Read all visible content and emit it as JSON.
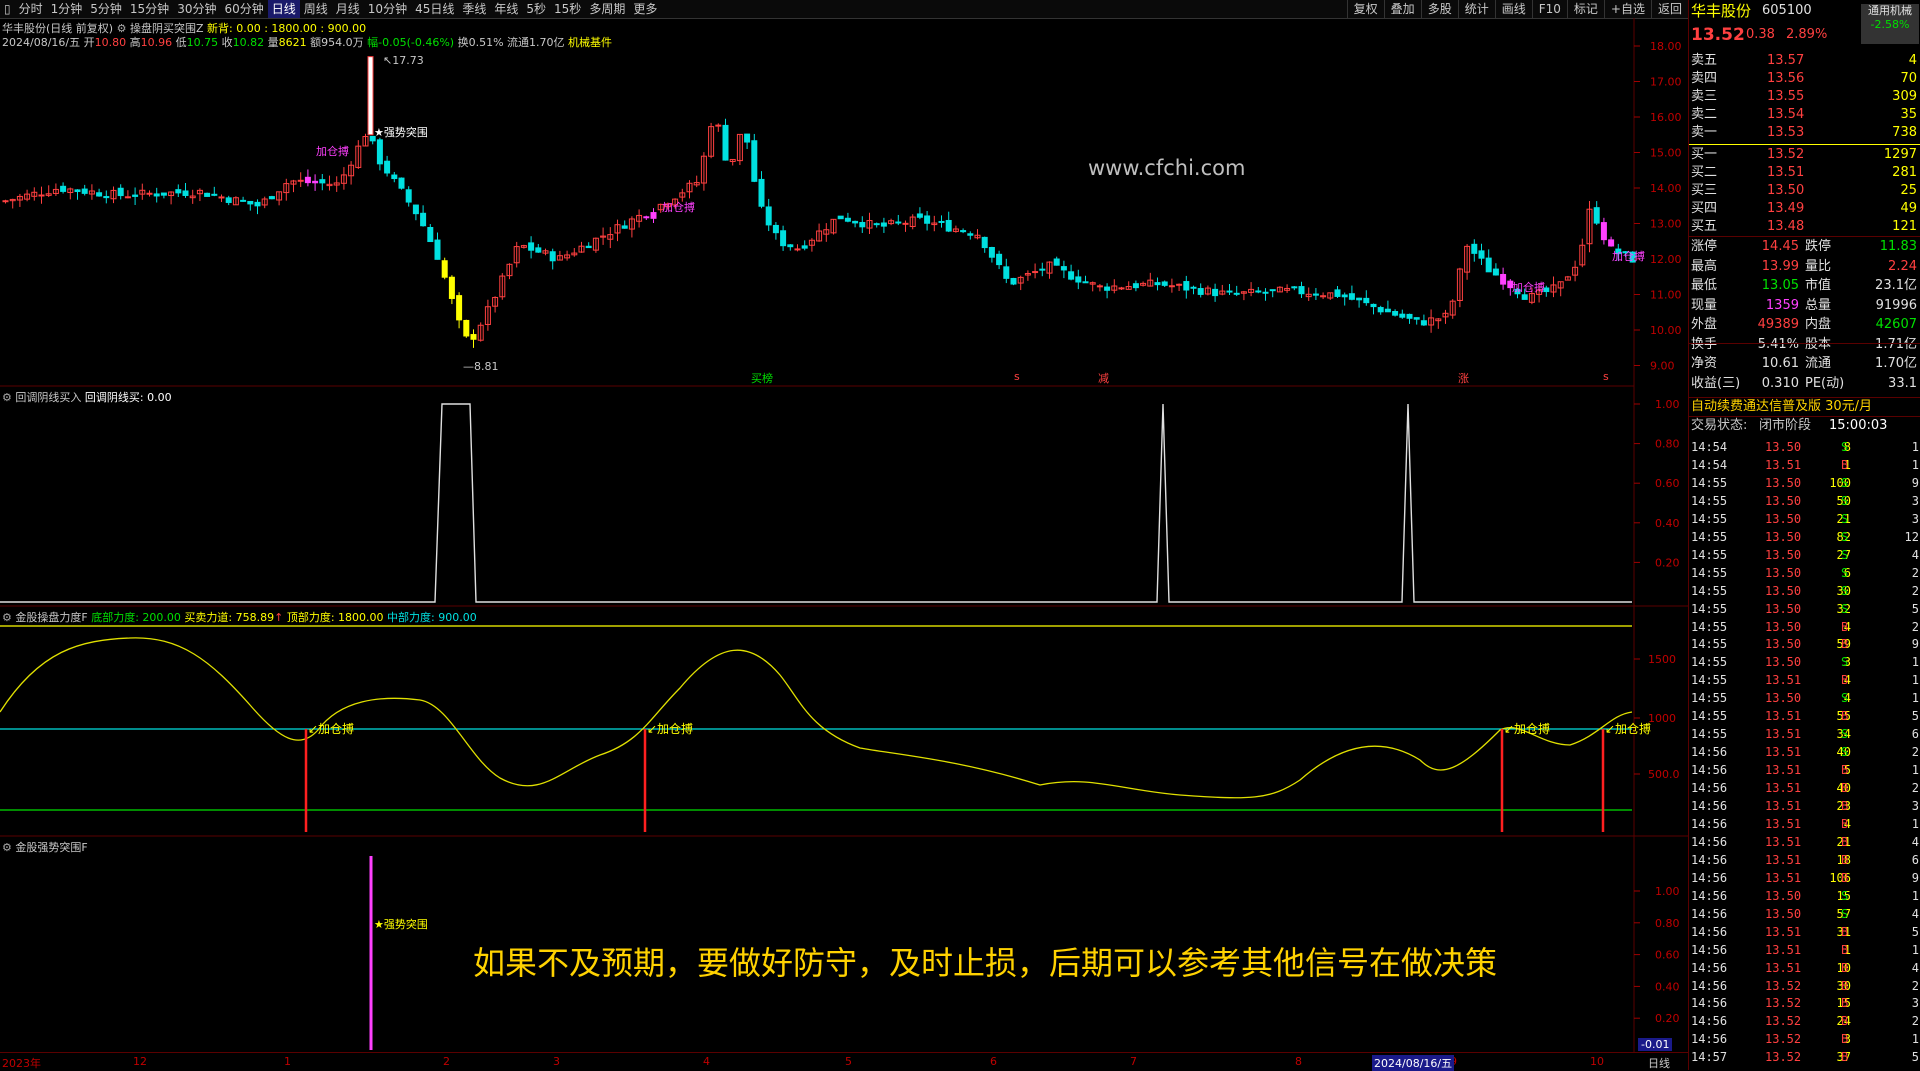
{
  "toolbar": {
    "periods": [
      "分时",
      "1分钟",
      "5分钟",
      "15分钟",
      "30分钟",
      "60分钟",
      "日线",
      "周线",
      "月线",
      "10分钟",
      "45日线",
      "季线",
      "年线",
      "5秒",
      "15秒",
      "多周期",
      "更多"
    ],
    "active_period": "日线",
    "right": [
      "复权",
      "叠加",
      "多股",
      "统计",
      "画线",
      "F10",
      "标记",
      "+自选",
      "返回"
    ]
  },
  "header": {
    "stock_line": "华丰股份(日线 前复权)",
    "indicator_name": "操盘阴买突围Z",
    "indicator_params": "新背: 0.00 : 1800.00 : 900.00",
    "date": "2024/08/16/五",
    "open_label": "开",
    "open": "10.80",
    "high_label": "高",
    "high": "10.96",
    "low_label": "低",
    "low": "10.75",
    "close_label": "收",
    "close": "10.82",
    "vol_label": "量",
    "vol": "8621",
    "amount": "额954.0万",
    "change": "幅-0.05(-0.46%)",
    "turnover": "换0.51%",
    "float": "流通1.70亿",
    "sector": "机械基件"
  },
  "main_chart": {
    "y_ticks": [
      "18.00",
      "17.00",
      "16.00",
      "15.00",
      "14.00",
      "13.00",
      "12.00",
      "11.00",
      "10.00",
      "9.00"
    ],
    "high_label": "17.73",
    "low_label": "8.81",
    "signal_breakout": "★强势突围",
    "signal_add": "加仓搏",
    "bottom_markers": [
      "买榜",
      "s",
      "减",
      "涨",
      "s"
    ]
  },
  "panel2": {
    "title": "回调阴线买入",
    "value_label": "回调阴线买: 0.00",
    "y_ticks": [
      "1.00",
      "0.80",
      "0.60",
      "0.40",
      "0.20"
    ]
  },
  "panel3": {
    "title": "金股操盘力度F",
    "bottom_label": "底部力度: 200.00",
    "trade_label": "买卖力道: 758.89",
    "trade_arrow": "↑",
    "top_label": "顶部力度: 1800.00",
    "mid_label": "中部力度: 900.00",
    "y_ticks": [
      "1500",
      "1000",
      "500.0"
    ],
    "signal": "加仓搏"
  },
  "panel4": {
    "title": "金股强势突围F",
    "y_ticks": [
      "1.00",
      "0.80",
      "0.60",
      "0.40",
      "0.20"
    ],
    "signal": "★强势突围",
    "neg_value": "-0.01"
  },
  "x_axis": {
    "labels": [
      "2023年",
      "12",
      "1",
      "2",
      "3",
      "4",
      "5",
      "6",
      "7",
      "8",
      "9",
      "10"
    ],
    "current_date": "2024/08/16/五",
    "period": "日线"
  },
  "watermark": "www.cfchi.com",
  "overlay_text": "如果不及预期，要做好防守，及时止损，后期可以参考其他信号在做决策",
  "quote": {
    "name": "华丰股份",
    "code": "605100",
    "tag": "通用机械",
    "price": "13.52",
    "change": "0.38",
    "pct": "2.89%",
    "side_value": "-2.58%",
    "asks": [
      {
        "label": "卖五",
        "price": "13.57",
        "vol": "4"
      },
      {
        "label": "卖四",
        "price": "13.56",
        "vol": "70"
      },
      {
        "label": "卖三",
        "price": "13.55",
        "vol": "309"
      },
      {
        "label": "卖二",
        "price": "13.54",
        "vol": "35"
      },
      {
        "label": "卖一",
        "price": "13.53",
        "vol": "738"
      }
    ],
    "bids": [
      {
        "label": "买一",
        "price": "13.52",
        "vol": "1297"
      },
      {
        "label": "买二",
        "price": "13.51",
        "vol": "281"
      },
      {
        "label": "买三",
        "price": "13.50",
        "vol": "25"
      },
      {
        "label": "买四",
        "price": "13.49",
        "vol": "49"
      },
      {
        "label": "买五",
        "price": "13.48",
        "vol": "121"
      }
    ],
    "stats": [
      {
        "l1": "涨停",
        "v1": "14.45",
        "l2": "跌停",
        "v2": "11.83",
        "c1": "#ff4040",
        "c2": "#00e000"
      },
      {
        "l1": "最高",
        "v1": "13.99",
        "l2": "量比",
        "v2": "2.24",
        "c1": "#ff4040",
        "c2": "#ff4040"
      },
      {
        "l1": "最低",
        "v1": "13.05",
        "l2": "市值",
        "v2": "23.1亿",
        "c1": "#00e000",
        "c2": "#e0e0e0"
      },
      {
        "l1": "现量",
        "v1": "1359",
        "l2": "总量",
        "v2": "91996",
        "c1": "#ff40ff",
        "c2": "#e0e0e0"
      },
      {
        "l1": "外盘",
        "v1": "49389",
        "l2": "内盘",
        "v2": "42607",
        "c1": "#ff4040",
        "c2": "#00e000"
      },
      {
        "l1": "换手",
        "v1": "5.41%",
        "l2": "股本",
        "v2": "1.71亿",
        "c1": "#e0e0e0",
        "c2": "#e0e0e0"
      },
      {
        "l1": "净资",
        "v1": "10.61",
        "l2": "流通",
        "v2": "1.70亿",
        "c1": "#e0e0e0",
        "c2": "#e0e0e0"
      },
      {
        "l1": "收益(三)",
        "v1": "0.310",
        "l2": "PE(动)",
        "v2": "33.1",
        "c1": "#e0e0e0",
        "c2": "#e0e0e0"
      }
    ],
    "promo": "自动续费通达信普及版 30元/月",
    "trade_status_label": "交易状态:",
    "trade_status": "闭市阶段",
    "trade_time": "15:00:03"
  },
  "ticks": [
    [
      "14:54",
      "13.50",
      "8",
      "S",
      "1"
    ],
    [
      "14:54",
      "13.51",
      "1",
      "B",
      "1"
    ],
    [
      "14:55",
      "13.50",
      "100",
      "S",
      "9"
    ],
    [
      "14:55",
      "13.50",
      "50",
      "S",
      "3"
    ],
    [
      "14:55",
      "13.50",
      "21",
      "S",
      "3"
    ],
    [
      "14:55",
      "13.50",
      "82",
      "S",
      "12"
    ],
    [
      "14:55",
      "13.50",
      "27",
      "S",
      "4"
    ],
    [
      "14:55",
      "13.50",
      "6",
      "S",
      "2"
    ],
    [
      "14:55",
      "13.50",
      "30",
      "S",
      "2"
    ],
    [
      "14:55",
      "13.50",
      "32",
      "S",
      "5"
    ],
    [
      "14:55",
      "13.50",
      "4",
      "B",
      "2"
    ],
    [
      "14:55",
      "13.50",
      "59",
      "B",
      "9"
    ],
    [
      "14:55",
      "13.50",
      "3",
      "S",
      "1"
    ],
    [
      "14:55",
      "13.51",
      "4",
      "B",
      "1"
    ],
    [
      "14:55",
      "13.50",
      "4",
      "S",
      "1"
    ],
    [
      "14:55",
      "13.51",
      "55",
      "B",
      "5"
    ],
    [
      "14:55",
      "13.51",
      "34",
      "S",
      "6"
    ],
    [
      "14:56",
      "13.51",
      "40",
      "S",
      "2"
    ],
    [
      "14:56",
      "13.51",
      "5",
      "B",
      "1"
    ],
    [
      "14:56",
      "13.51",
      "40",
      "B",
      "2"
    ],
    [
      "14:56",
      "13.51",
      "23",
      "B",
      "3"
    ],
    [
      "14:56",
      "13.51",
      "4",
      "B",
      "1"
    ],
    [
      "14:56",
      "13.51",
      "21",
      "B",
      "4"
    ],
    [
      "14:56",
      "13.51",
      "18",
      "B",
      "6"
    ],
    [
      "14:56",
      "13.51",
      "106",
      "B",
      "9"
    ],
    [
      "14:56",
      "13.50",
      "15",
      "S",
      "1"
    ],
    [
      "14:56",
      "13.50",
      "57",
      "S",
      "4"
    ],
    [
      "14:56",
      "13.51",
      "31",
      "B",
      "5"
    ],
    [
      "14:56",
      "13.51",
      "1",
      "B",
      "1"
    ],
    [
      "14:56",
      "13.51",
      "10",
      "B",
      "4"
    ],
    [
      "14:56",
      "13.52",
      "30",
      "B",
      "2"
    ],
    [
      "14:56",
      "13.52",
      "15",
      "B",
      "3"
    ],
    [
      "14:56",
      "13.52",
      "24",
      "B",
      "2"
    ],
    [
      "14:56",
      "13.52",
      "3",
      "B",
      "1"
    ],
    [
      "14:57",
      "13.52",
      "37",
      "B",
      "5"
    ]
  ]
}
